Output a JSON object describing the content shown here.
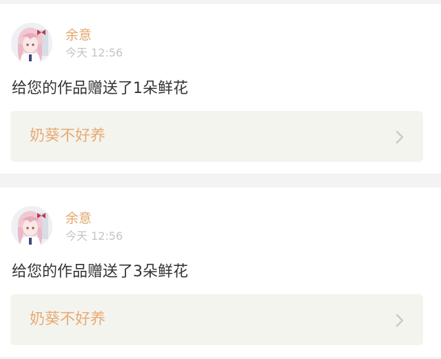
{
  "notifications": [
    {
      "username": "余意",
      "time": "今天 12:56",
      "message": "给您的作品赠送了1朵鲜花",
      "work_title": "奶葵不好养",
      "avatar_icon": "anime-girl-avatar",
      "link_icon": "chevron-right-icon"
    },
    {
      "username": "余意",
      "time": "今天 12:56",
      "message": "给您的作品赠送了3朵鲜花",
      "work_title": "奶葵不好养",
      "avatar_icon": "anime-girl-avatar",
      "link_icon": "chevron-right-icon"
    }
  ],
  "colors": {
    "username": "#e2a66c",
    "timestamp": "#c4c4c4",
    "message": "#333333",
    "link_bg": "#f4f4ee",
    "link_text": "#e7aa74",
    "chevron": "#c9c9c9",
    "page_bg": "#f3f3f3"
  }
}
